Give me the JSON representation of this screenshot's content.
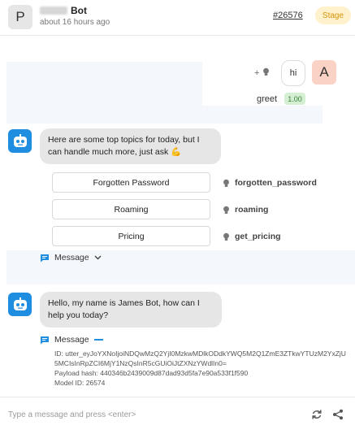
{
  "header": {
    "avatar_letter": "P",
    "bot_name": "Bot",
    "timestamp": "about 16 hours ago",
    "conversation_id": "#26576",
    "stage_badge": "Stage"
  },
  "user_turn": {
    "plus_label": "+",
    "message": "hi",
    "avatar_letter": "A",
    "intent": "greet",
    "confidence": "1.00"
  },
  "bot_turn_1": {
    "text": "Here are some top topics for today, but I can handle much more, just ask 💪",
    "quick_replies": [
      {
        "label": "Forgotten Password",
        "intent": "forgotten_password"
      },
      {
        "label": "Roaming",
        "intent": "roaming"
      },
      {
        "label": "Pricing",
        "intent": "get_pricing"
      }
    ],
    "message_toggle": "Message"
  },
  "bot_turn_2": {
    "text": "Hello, my name is James Bot, how can I help you today?",
    "message_toggle": "Message",
    "meta": {
      "id_line": "ID: utter_eyJoYXNoIjoiNDQwMzQ2YjI0MzkwMDlkODdkYWQ5M2Q1ZmE3ZTkwYTUzM2YxZjU5MCIsInRpZCI6MjY1NzQsInR5cGUiOiJtZXNzYWdlIn0=",
      "payload_line": "Payload hash: 440346b2439009d87dad93d5fa7e90a533f1f590",
      "model_line": "Model ID: 26574"
    }
  },
  "composer": {
    "placeholder": "Type a message and press <enter>"
  },
  "colors": {
    "bot_avatar": "#1f8de0",
    "stage_badge_bg": "#fff1cc",
    "stage_badge_text": "#d4950a",
    "confidence_bg": "#d5efd3",
    "user_avatar_bg": "#fbd3c6"
  },
  "icons": {
    "bot": "robot-icon",
    "bulb": "lightbulb-icon",
    "message": "chat-bubble-icon",
    "refresh": "refresh-icon",
    "share": "share-icon"
  }
}
